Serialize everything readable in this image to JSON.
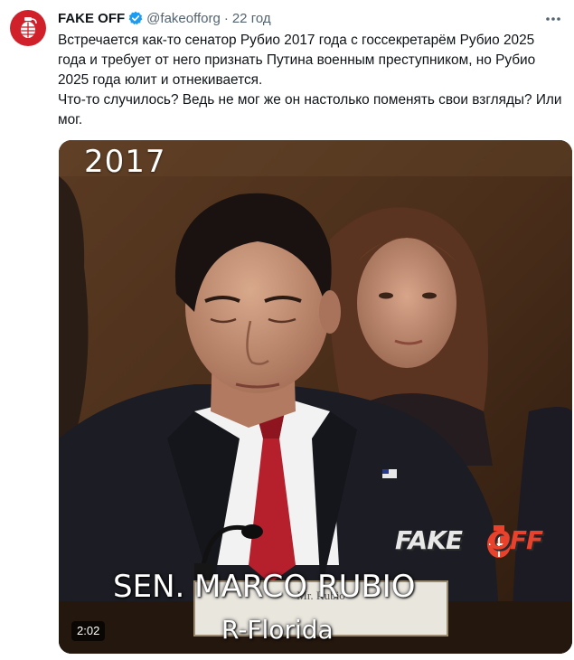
{
  "tweet": {
    "author": {
      "display_name": "FAKE OFF",
      "handle": "@fakeofforg",
      "verified_icon": "verified-badge-icon",
      "avatar_icon": "grenade-icon"
    },
    "separator": "·",
    "time": "22 год",
    "more_icon": "more-dots-icon",
    "text_lines": [
      "Встречается как-то сенатор Рубио 2017 года с госсекретарём Рубио 2025 года и требует от него признать Путина военным преступником, но Рубио 2025 года юлит и отнекивается.",
      "Что-то случилось? Ведь не мог же он настолько поменять свои взгляды? Или мог."
    ],
    "media": {
      "year_overlay": "2017",
      "caption_name": "SEN. MARCO RUBIO",
      "caption_party": "R-Florida",
      "placard_text": "Mr. Rubio",
      "watermark_fake": "FAKE",
      "watermark_off": "OFF",
      "duration": "2:02"
    }
  },
  "colors": {
    "brand_red": "#d0202a",
    "verified_blue": "#1d9bf0",
    "muted_text": "#536471",
    "tie_red": "#b5202c"
  }
}
